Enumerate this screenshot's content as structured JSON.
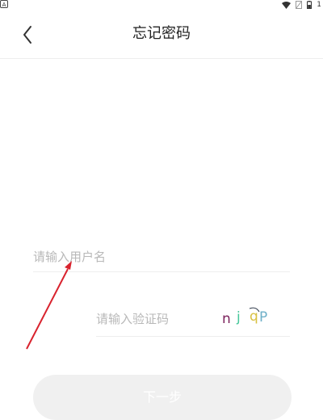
{
  "status_bar": {
    "left_icon_text": "A",
    "right_number": "1"
  },
  "header": {
    "title": "忘记密码",
    "back_icon": "chevron-left-icon"
  },
  "form": {
    "username_placeholder": "请输入用户名",
    "username_value": "",
    "captcha_placeholder": "请输入验证码",
    "captcha_value": "",
    "captcha_chars": [
      {
        "char": "n",
        "color": "#7a1f5a"
      },
      {
        "char": "j",
        "color": "#46c79a"
      },
      {
        "char": "q",
        "color": "#d8c040"
      },
      {
        "char": "P",
        "color": "#6fb0c8"
      }
    ]
  },
  "next_button": {
    "label": "下一步"
  },
  "annotation": {
    "type": "arrow",
    "color": "#d9232e"
  }
}
